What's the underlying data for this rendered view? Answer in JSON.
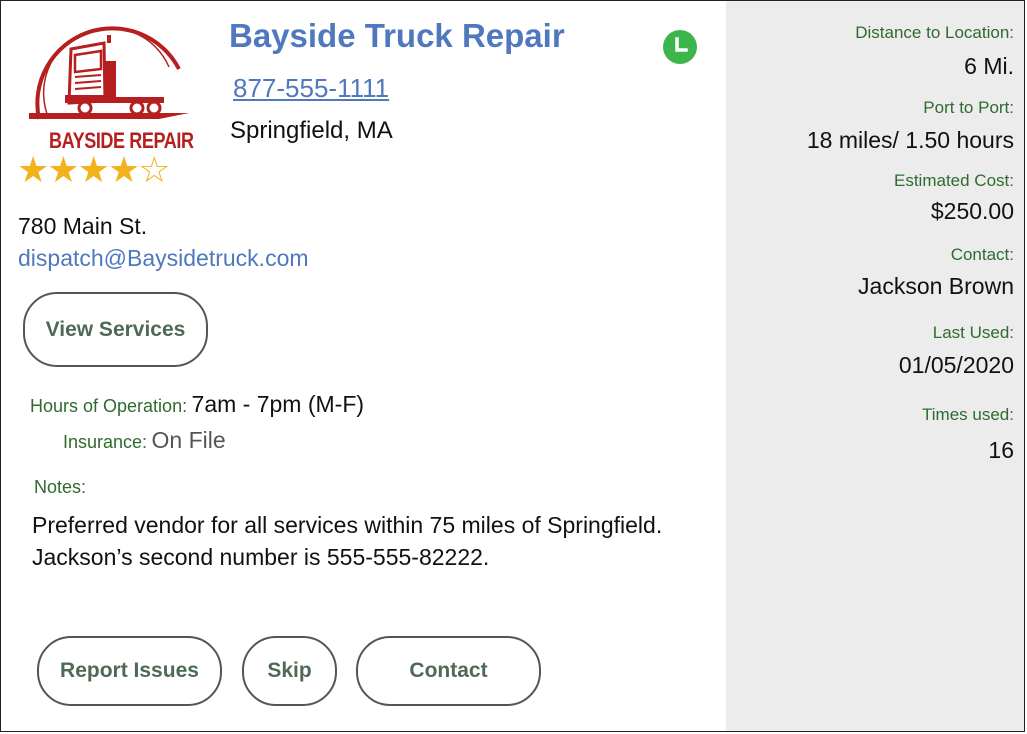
{
  "vendor": {
    "name": "Bayside Truck Repair",
    "phone": "877-555-1111",
    "city": "Springfield, MA",
    "logo_text": "BAYSIDE REPAIR",
    "rating": 4,
    "rating_max": 5,
    "stars_text": "★★★★☆",
    "address": "780 Main St.",
    "email": "dispatch@Baysidetruck.com",
    "status_color": "#3cb54a"
  },
  "buttons": {
    "view_services": "View Services",
    "report_issues": "Report Issues",
    "skip": "Skip",
    "contact": "Contact"
  },
  "details": {
    "hours_label": "Hours of Operation:",
    "hours_value": "7am - 7pm (M-F)",
    "insurance_label": "Insurance:",
    "insurance_value": "On File",
    "notes_label": "Notes:",
    "notes_text": "Preferred vendor for all services within 75 miles of Springfield.  Jackson’s second number is 555-555-82222."
  },
  "sidebar": {
    "distance_label": "Distance to Location:",
    "distance_value": "6 Mi.",
    "port_label": "Port to Port:",
    "port_value": "18 miles/ 1.50 hours",
    "cost_label": "Estimated Cost:",
    "cost_value": "$250.00",
    "contact_label": "Contact:",
    "contact_value": "Jackson Brown",
    "last_used_label": "Last Used:",
    "last_used_value": "01/05/2020",
    "times_used_label": "Times used:",
    "times_used_value": "16"
  },
  "colors": {
    "accent_blue": "#4f78bf",
    "label_green": "#2f6b2f",
    "logo_red": "#b51f1f",
    "star_gold": "#f2b21c",
    "sidebar_bg": "#ececec"
  }
}
